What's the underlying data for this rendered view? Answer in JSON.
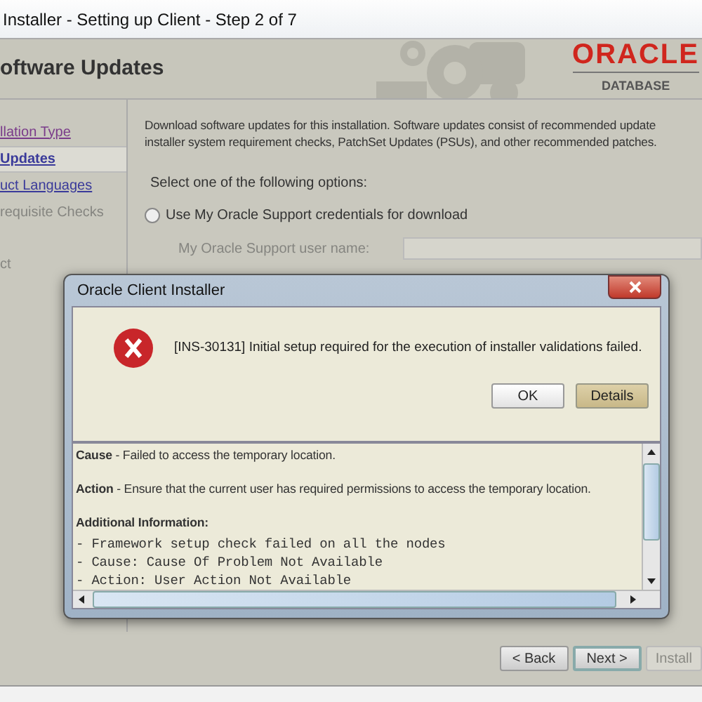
{
  "window": {
    "title": "Installer - Setting up Client - Step 2 of 7"
  },
  "header": {
    "title": "oftware Updates",
    "logo_brand": "ORACLE",
    "logo_product": "DATABASE"
  },
  "sidebar": {
    "items": [
      {
        "label": "llation Type",
        "kind": "visited",
        "selected": false
      },
      {
        "label": "Updates",
        "kind": "link",
        "selected": true
      },
      {
        "label": "uct Languages",
        "kind": "link",
        "selected": false
      },
      {
        "label": "requisite Checks",
        "kind": "disabled",
        "selected": false
      },
      {
        "label": "ct",
        "kind": "disabled",
        "selected": false
      }
    ]
  },
  "content": {
    "description_lines": [
      "Download software updates for this installation. Software updates consist of recommended update",
      "installer system requirement checks, PatchSet Updates (PSUs), and other recommended patches."
    ],
    "prompt": "Select one of the following options:",
    "options": [
      {
        "label": "Use My Oracle Support credentials for download",
        "selected": false
      }
    ],
    "fields": [
      {
        "label": "My Oracle Support user name:",
        "disabled": true
      }
    ]
  },
  "nav_buttons": [
    {
      "label": "< Back",
      "disabled": false,
      "default": false
    },
    {
      "label": "Next >",
      "disabled": false,
      "default": true
    },
    {
      "label": "Install",
      "disabled": true,
      "default": false
    }
  ],
  "dialog": {
    "title": "Oracle Client Installer",
    "message": "[INS-30131] Initial setup required for the execution of installer validations failed.",
    "buttons": [
      {
        "label": "OK",
        "pressed": false
      },
      {
        "label": "Details",
        "pressed": true
      }
    ],
    "details": [
      {
        "kind": "text",
        "text": "**Cause** - Failed to access the temporary location."
      },
      {
        "kind": "text",
        "text": "**Action** - Ensure that the current user has required permissions to access the temporary location."
      },
      {
        "kind": "heading",
        "text": "Additional Information:"
      },
      {
        "kind": "code",
        "text": "- Framework setup check failed on all the nodes"
      },
      {
        "kind": "code",
        "text": "- Cause: Cause Of Problem Not Available"
      },
      {
        "kind": "code",
        "text": "- Action: User Action Not Available"
      }
    ]
  }
}
